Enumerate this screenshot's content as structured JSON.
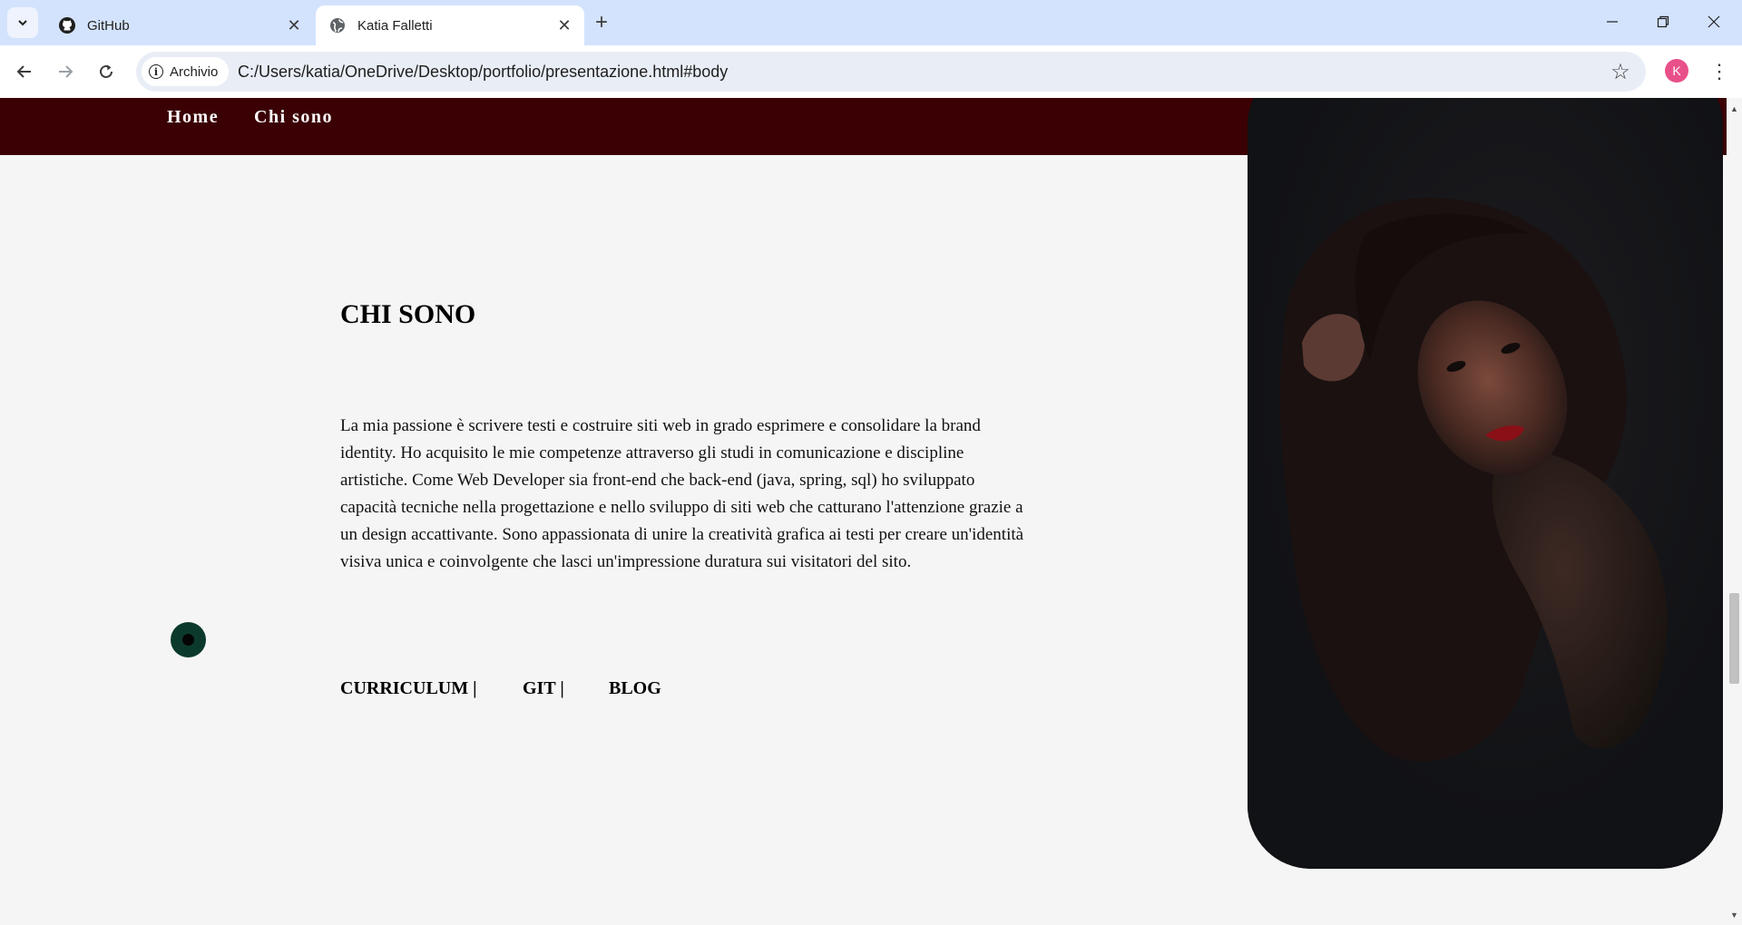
{
  "browser": {
    "tabs": [
      {
        "title": "GitHub",
        "icon": "github-icon",
        "active": false
      },
      {
        "title": "Katia Falletti",
        "icon": "globe-icon",
        "active": true
      }
    ],
    "security_chip": "Archivio",
    "url": "C:/Users/katia/OneDrive/Desktop/portfolio/presentazione.html#body",
    "profile_initial": "K",
    "profile_color": "#e8508a"
  },
  "site": {
    "nav": {
      "home": "Home",
      "about": "Chi sono"
    },
    "nav_color": "#3b0003",
    "section_title": "CHI SONO",
    "about_text": "La mia passione è scrivere testi e costruire siti web in grado esprimere e consolidare la brand identity. Ho acquisito le mie competenze attraverso gli studi in comunicazione e discipline artistiche. Come Web Developer sia front-end che back-end (java, spring, sql) ho sviluppato capacità tecniche nella progettazione e nello sviluppo di siti web che catturano l'attenzione grazie a un design accattivante. Sono appassionata di unire la creatività grafica ai testi per creare un'identità visiva unica e coinvolgente che lasci un'impressione duratura sui visitatori del sito.",
    "links": {
      "curriculum": "CURRICULUM |",
      "git": "GIT |",
      "blog": "BLOG"
    }
  }
}
